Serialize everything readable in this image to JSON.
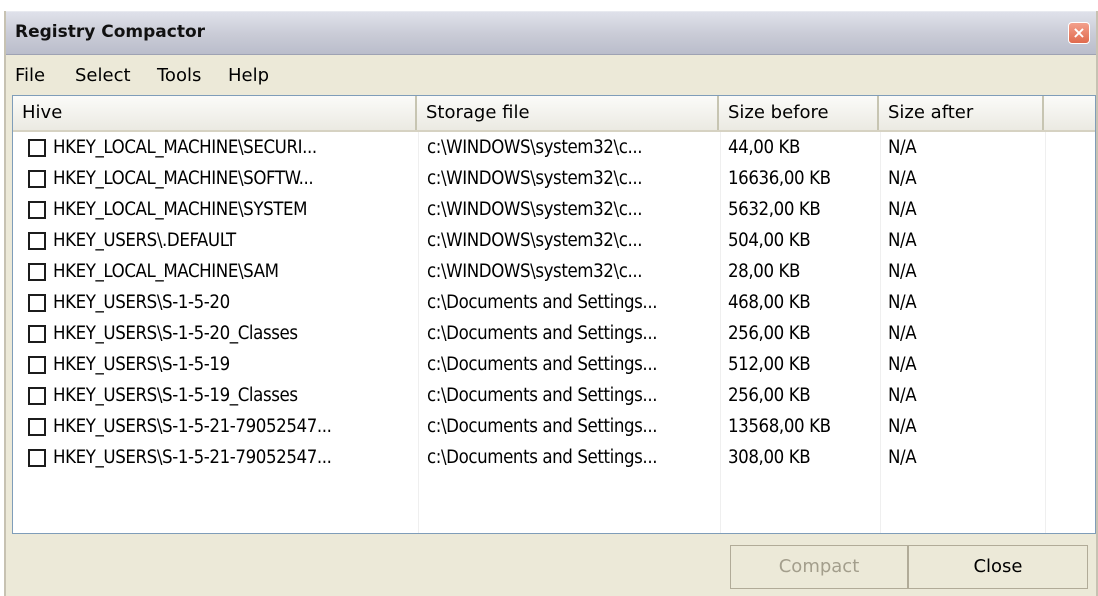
{
  "window": {
    "title": "Registry Compactor",
    "close_glyph": "×"
  },
  "menu": {
    "items": [
      "File",
      "Select",
      "Tools",
      "Help"
    ]
  },
  "table": {
    "columns": [
      "Hive",
      "Storage file",
      "Size before",
      "Size after"
    ],
    "rows": [
      {
        "hive": "HKEY_LOCAL_MACHINE\\SECURI...",
        "storage": "c:\\WINDOWS\\system32\\c...",
        "before": "44,00 KB",
        "after": "N/A"
      },
      {
        "hive": "HKEY_LOCAL_MACHINE\\SOFTW...",
        "storage": "c:\\WINDOWS\\system32\\c...",
        "before": "16636,00 KB",
        "after": "N/A"
      },
      {
        "hive": "HKEY_LOCAL_MACHINE\\SYSTEM",
        "storage": "c:\\WINDOWS\\system32\\c...",
        "before": "5632,00 KB",
        "after": "N/A"
      },
      {
        "hive": "HKEY_USERS\\.DEFAULT",
        "storage": "c:\\WINDOWS\\system32\\c...",
        "before": "504,00 KB",
        "after": "N/A"
      },
      {
        "hive": "HKEY_LOCAL_MACHINE\\SAM",
        "storage": "c:\\WINDOWS\\system32\\c...",
        "before": "28,00 KB",
        "after": "N/A"
      },
      {
        "hive": "HKEY_USERS\\S-1-5-20",
        "storage": "c:\\Documents and Settings...",
        "before": "468,00 KB",
        "after": "N/A"
      },
      {
        "hive": "HKEY_USERS\\S-1-5-20_Classes",
        "storage": "c:\\Documents and Settings...",
        "before": "256,00 KB",
        "after": "N/A"
      },
      {
        "hive": "HKEY_USERS\\S-1-5-19",
        "storage": "c:\\Documents and Settings...",
        "before": "512,00 KB",
        "after": "N/A"
      },
      {
        "hive": "HKEY_USERS\\S-1-5-19_Classes",
        "storage": "c:\\Documents and Settings...",
        "before": "256,00 KB",
        "after": "N/A"
      },
      {
        "hive": "HKEY_USERS\\S-1-5-21-79052547...",
        "storage": "c:\\Documents and Settings...",
        "before": "13568,00 KB",
        "after": "N/A"
      },
      {
        "hive": "HKEY_USERS\\S-1-5-21-79052547...",
        "storage": "c:\\Documents and Settings...",
        "before": "308,00 KB",
        "after": "N/A"
      }
    ]
  },
  "buttons": {
    "compact": "Compact",
    "close": "Close"
  }
}
